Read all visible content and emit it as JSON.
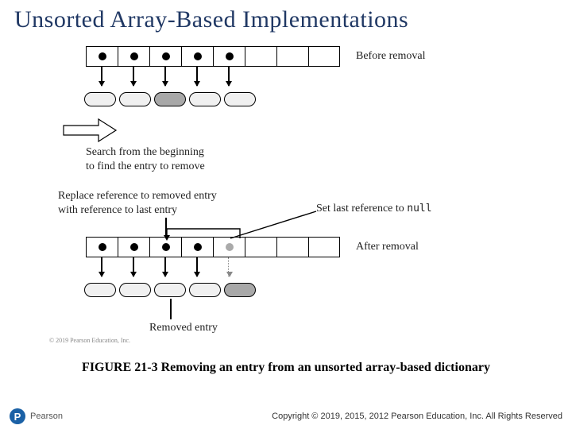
{
  "title": "Unsorted Array-Based Implementations",
  "labels": {
    "before": "Before removal",
    "after": "After removal",
    "search_l1": "Search from the beginning",
    "search_l2": "to find the entry to remove",
    "replace_l1": "Replace reference to removed entry",
    "replace_l2": "with reference to last entry",
    "set_null": "Set last reference to ",
    "null_code": "null",
    "removed": "Removed entry",
    "img_copy": "© 2019 Pearson Education, Inc."
  },
  "caption": "FIGURE 21-3 Removing an entry from an unsorted array-based dictionary",
  "footer": {
    "brand": "Pearson",
    "copyright": "Copyright © 2019, 2015, 2012 Pearson Education, Inc. All Rights Reserved"
  },
  "chart_data": {
    "type": "diagram",
    "top_array": {
      "cells": 8,
      "filled": [
        0,
        1,
        2,
        3,
        4
      ],
      "removed_index": 2,
      "label": "Before removal"
    },
    "bottom_array": {
      "cells": 8,
      "filled": [
        0,
        1,
        2,
        3
      ],
      "ghost_index": 4,
      "label": "After removal"
    },
    "steps": [
      "Search from the beginning to find the entry to remove",
      "Replace reference to removed entry with reference to last entry",
      "Set last reference to null"
    ]
  }
}
